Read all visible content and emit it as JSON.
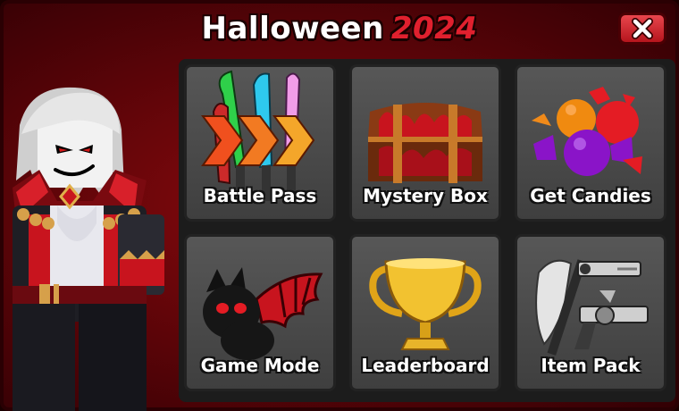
{
  "window": {
    "title_text": "Halloween",
    "title_year": "2024",
    "close_icon": "close-x-icon"
  },
  "colors": {
    "background_red": "#6a060a",
    "year_red": "#e0202e",
    "close_button_red": "#d23038",
    "tile_gray": "#4a4a4a",
    "grid_dark": "#1c1c1c"
  },
  "character": {
    "icon": "vampire-avatar-icon"
  },
  "menu": {
    "tiles": [
      {
        "label": "Battle Pass",
        "icon": "weapons-chevrons-icon"
      },
      {
        "label": "Mystery Box",
        "icon": "treasure-chest-icon"
      },
      {
        "label": "Get Candies",
        "icon": "candy-pile-icon"
      },
      {
        "label": "Game Mode",
        "icon": "bat-icon"
      },
      {
        "label": "Leaderboard",
        "icon": "trophy-icon"
      },
      {
        "label": "Item Pack",
        "icon": "axe-and-revolver-icon"
      }
    ]
  }
}
